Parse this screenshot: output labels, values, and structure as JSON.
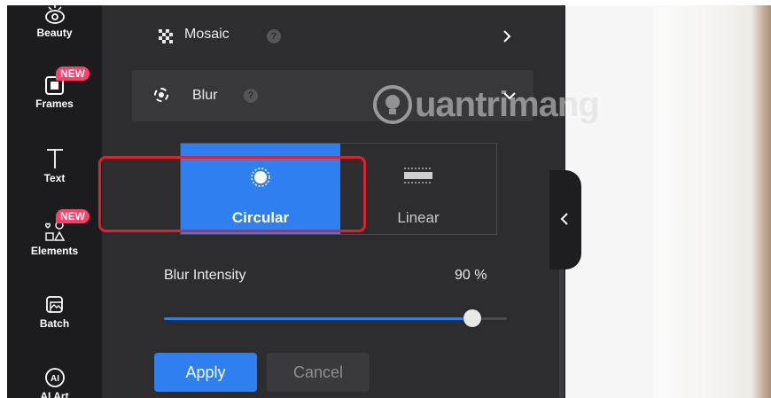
{
  "toolbar": {
    "items": [
      {
        "label": "Beauty",
        "icon": "eye-icon",
        "badge": ""
      },
      {
        "label": "Frames",
        "icon": "frame-icon",
        "badge": "NEW"
      },
      {
        "label": "Text",
        "icon": "text-icon",
        "badge": ""
      },
      {
        "label": "Elements",
        "icon": "shapes-icon",
        "badge": "NEW"
      },
      {
        "label": "Batch",
        "icon": "batch-icon",
        "badge": ""
      },
      {
        "label": "AI Art",
        "icon": "ai-icon",
        "badge": ""
      }
    ]
  },
  "panel": {
    "mosaic": {
      "label": "Mosaic",
      "help": "?"
    },
    "blur": {
      "label": "Blur",
      "help": "?"
    },
    "blur_type": {
      "options": [
        "Circular",
        "Linear"
      ],
      "selected": "Circular"
    },
    "intensity": {
      "label": "Blur Intensity",
      "value_text": "90 %",
      "value": 90
    },
    "actions": {
      "apply": "Apply",
      "cancel": "Cancel"
    }
  },
  "watermark": {
    "text": "uantrimang"
  },
  "colors": {
    "accent": "#2f7ff0",
    "panel_bg": "#2d2d30",
    "toolbar_bg": "#1c1c1e",
    "badge": "#ff3f6a",
    "highlight": "#e0202a"
  }
}
